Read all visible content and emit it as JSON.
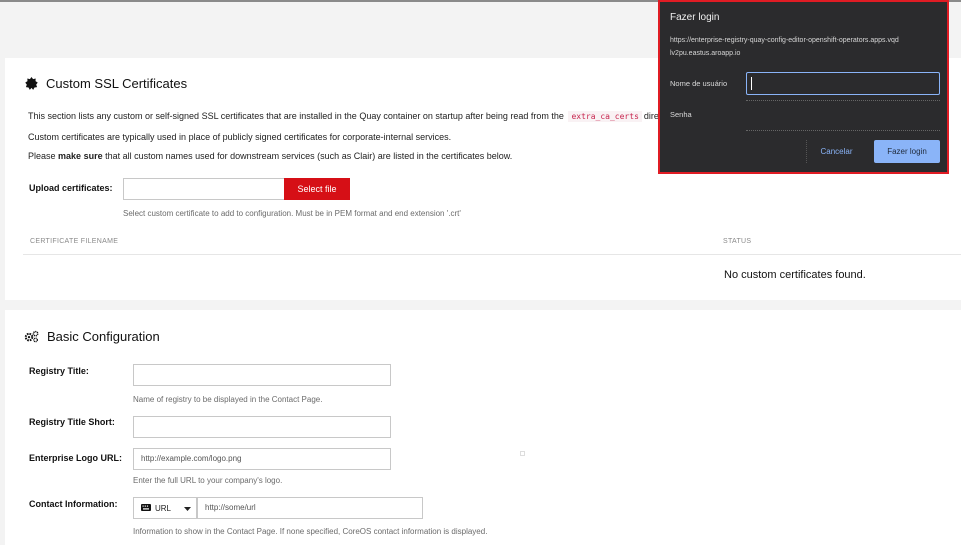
{
  "ssl": {
    "title": "Custom SSL Certificates",
    "desc1_prefix": "This section lists any custom or self-signed SSL certificates that are installed in the Quay container on startup after being read from the",
    "desc1_code": "extra_ca_certs",
    "desc1_suffix": "dire",
    "desc2": "Custom certificates are typically used in place of publicly signed certificates for corporate-internal services.",
    "desc3_prefix": "Please",
    "desc3_bold": "make sure",
    "desc3_suffix": "that all custom names used for downstream services (such as Clair) are listed in the certificates below.",
    "upload_label": "Upload certificates:",
    "select_file": "Select file",
    "upload_help": "Select custom certificate to add to configuration. Must be in PEM format and end extension '.crt'",
    "col_filename": "CERTIFICATE FILENAME",
    "col_status": "STATUS",
    "empty_message": "No custom certificates found."
  },
  "basic": {
    "title": "Basic Configuration",
    "registry_title_label": "Registry Title:",
    "registry_title_value": "",
    "registry_title_help": "Name of registry to be displayed in the Contact Page.",
    "registry_title_short_label": "Registry Title Short:",
    "registry_title_short_value": "",
    "logo_label": "Enterprise Logo URL:",
    "logo_placeholder": "http://example.com/logo.png",
    "logo_help": "Enter the full URL to your company's logo.",
    "contact_label": "Contact Information:",
    "contact_type": "URL",
    "contact_placeholder": "http://some/url",
    "contact_help": "Information to show in the Contact Page. If none specified, CoreOS contact information is displayed."
  },
  "dialog": {
    "title": "Fazer login",
    "url": "https://enterprise-registry-quay-config-editor-openshift-operators.apps.vqdlv2pu.eastus.aroapp.io",
    "username_label": "Nome de usuário",
    "password_label": "Senha",
    "cancel_label": "Cancelar",
    "login_label": "Fazer login"
  },
  "colors": {
    "accent_red": "#d60f16",
    "dialog_bg": "#2b2b2d",
    "dialog_border": "#e01c24",
    "dialog_button": "#8ab4f8"
  }
}
